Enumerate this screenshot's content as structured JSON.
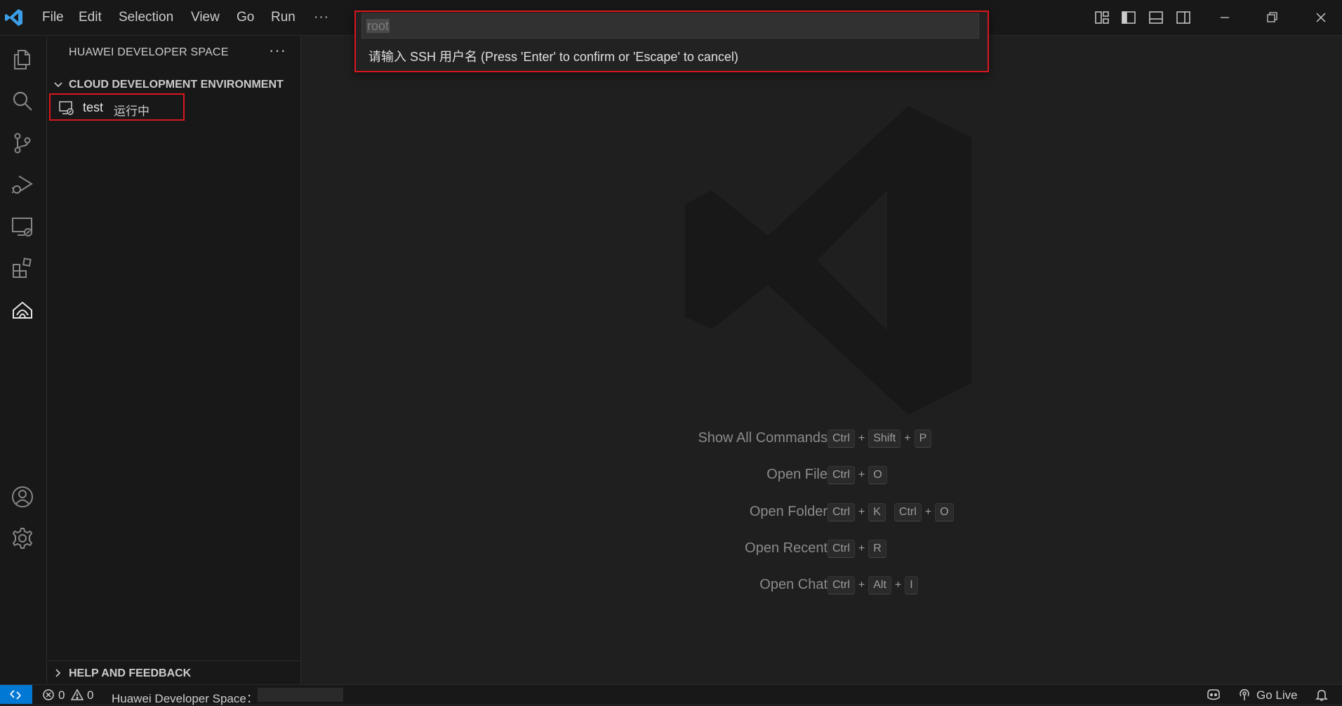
{
  "titlebar": {
    "menu": {
      "file": "File",
      "edit": "Edit",
      "selection": "Selection",
      "view": "View",
      "go": "Go",
      "run": "Run",
      "more": "···"
    },
    "icons": [
      "vscode-logo-icon",
      "customize-layout-icon",
      "toggle-primary-sidebar-icon",
      "toggle-panel-icon",
      "toggle-secondary-sidebar-icon",
      "minimize-icon",
      "restore-icon",
      "close-icon"
    ]
  },
  "activitybar": {
    "items": [
      "explorer-icon",
      "search-icon",
      "source-control-icon",
      "run-debug-icon",
      "remote-explorer-icon",
      "extensions-icon",
      "huawei-developer-space-icon"
    ],
    "bottom": [
      "accounts-icon",
      "settings-gear-icon"
    ]
  },
  "sidebar": {
    "title": "HUAWEI DEVELOPER SPACE",
    "more": "···",
    "section_cde": "CLOUD DEVELOPMENT ENVIRONMENT",
    "environment": {
      "name": "test",
      "status": "运行中"
    },
    "section_help": "HELP AND FEEDBACK"
  },
  "quick_input": {
    "value": "root",
    "prompt": "请输入 SSH 用户名 (Press 'Enter' to confirm or 'Escape' to cancel)"
  },
  "editor": {
    "shortcuts": [
      {
        "label": "Show All Commands",
        "keys": [
          [
            "Ctrl",
            "Shift",
            "P"
          ]
        ]
      },
      {
        "label": "Open File",
        "keys": [
          [
            "Ctrl",
            "O"
          ]
        ]
      },
      {
        "label": "Open Folder",
        "keys": [
          [
            "Ctrl",
            "K"
          ],
          [
            "Ctrl",
            "O"
          ]
        ]
      },
      {
        "label": "Open Recent",
        "keys": [
          [
            "Ctrl",
            "R"
          ]
        ]
      },
      {
        "label": "Open Chat",
        "keys": [
          [
            "Ctrl",
            "Alt",
            "I"
          ]
        ]
      }
    ]
  },
  "statusbar": {
    "errors": "0",
    "warnings": "0",
    "space_label": "Huawei Developer Space：",
    "go_live": "Go Live"
  },
  "colors": {
    "accent": "#0078d4",
    "highlight_border": "#d9161e",
    "background": "#1f1f1f",
    "sidebar_bg": "#181818"
  }
}
